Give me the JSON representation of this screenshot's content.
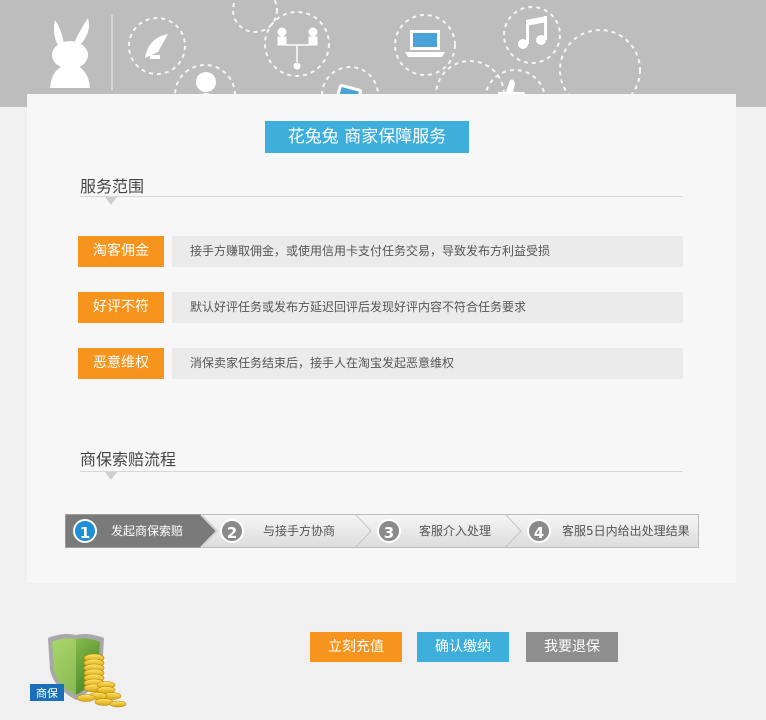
{
  "header": {
    "title": "花兔兔  商家保障服务"
  },
  "services": {
    "section_title": "服务范围",
    "items": [
      {
        "tag": "淘客佣金",
        "desc": "接手方赚取佣金，或使用信用卡支付任务交易，导致发布方利益受损"
      },
      {
        "tag": "好评不符",
        "desc": "默认好评任务或发布方延迟回评后发现好评内容不符合任务要求"
      },
      {
        "tag": "恶意维权",
        "desc": "消保卖家任务结束后，接手人在淘宝发起恶意维权"
      }
    ]
  },
  "process": {
    "section_title": "商保索赔流程",
    "steps": [
      {
        "num": "1",
        "label": "发起商保索赔"
      },
      {
        "num": "2",
        "label": "与接手方协商"
      },
      {
        "num": "3",
        "label": "客服介入处理"
      },
      {
        "num": "4",
        "label": "客服5日内给出处理结果"
      }
    ]
  },
  "footer": {
    "badge_label": "商保",
    "buttons": {
      "recharge": "立刻充值",
      "confirm_pay": "确认缴纳",
      "withdraw": "我要退保"
    }
  },
  "colors": {
    "accent_blue": "#3eaedb",
    "accent_orange": "#f7941d",
    "gray_button": "#8e8e8e",
    "banner_bg": "#bdbdbd"
  }
}
